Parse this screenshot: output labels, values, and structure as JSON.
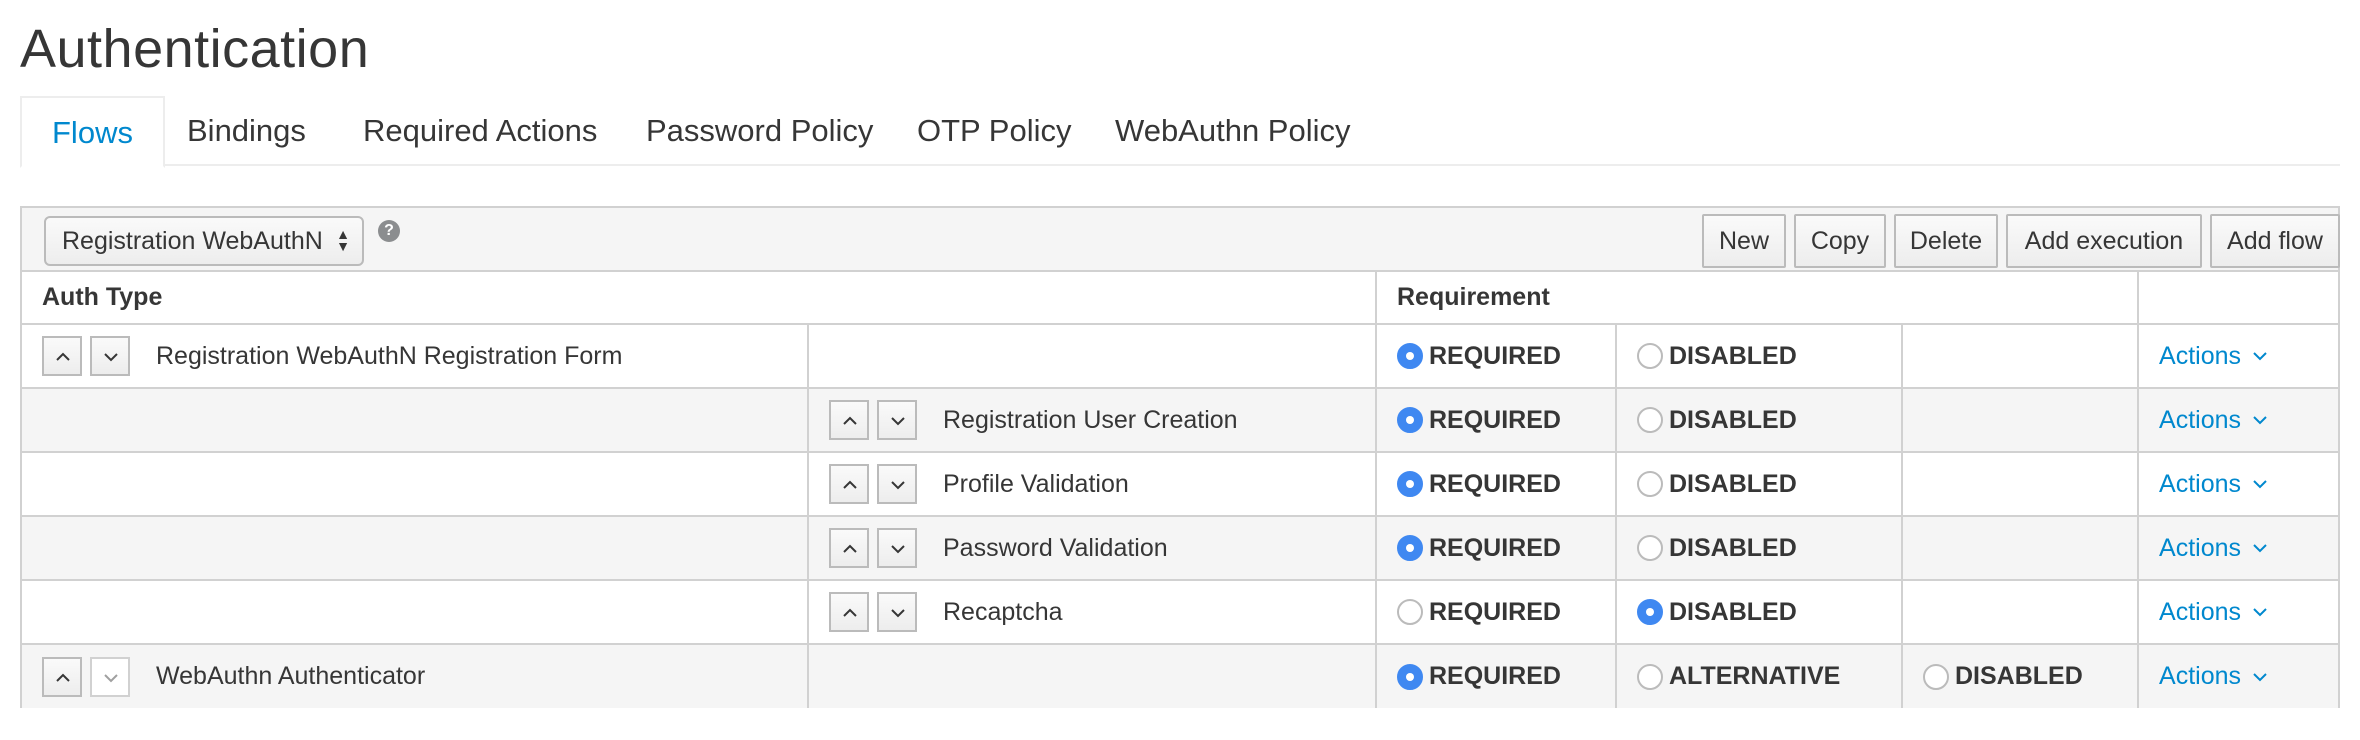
{
  "page": {
    "title": "Authentication"
  },
  "tabs": [
    {
      "label": "Flows",
      "active": true
    },
    {
      "label": "Bindings",
      "active": false
    },
    {
      "label": "Required Actions",
      "active": false
    },
    {
      "label": "Password Policy",
      "active": false
    },
    {
      "label": "OTP Policy",
      "active": false
    },
    {
      "label": "WebAuthn Policy",
      "active": false
    }
  ],
  "toolbar": {
    "flow_select_value": "Registration WebAuthN",
    "help_icon": "question-circle-icon",
    "buttons": {
      "new": "New",
      "copy": "Copy",
      "delete": "Delete",
      "add_execution": "Add execution",
      "add_flow": "Add flow"
    }
  },
  "table": {
    "headers": {
      "auth_type": "Auth Type",
      "requirement": "Requirement"
    },
    "rows": [
      {
        "name": "Registration WebAuthN Registration Form",
        "level": 0,
        "options": [
          "REQUIRED",
          "DISABLED"
        ],
        "selected": "REQUIRED",
        "actions": "Actions"
      },
      {
        "name": "Registration User Creation",
        "level": 1,
        "options": [
          "REQUIRED",
          "DISABLED"
        ],
        "selected": "REQUIRED",
        "actions": "Actions"
      },
      {
        "name": "Profile Validation",
        "level": 1,
        "options": [
          "REQUIRED",
          "DISABLED"
        ],
        "selected": "REQUIRED",
        "actions": "Actions"
      },
      {
        "name": "Password Validation",
        "level": 1,
        "options": [
          "REQUIRED",
          "DISABLED"
        ],
        "selected": "REQUIRED",
        "actions": "Actions"
      },
      {
        "name": "Recaptcha",
        "level": 1,
        "options": [
          "REQUIRED",
          "DISABLED"
        ],
        "selected": "DISABLED",
        "actions": "Actions"
      },
      {
        "name": "WebAuthn Authenticator",
        "level": 0,
        "options": [
          "REQUIRED",
          "ALTERNATIVE",
          "DISABLED"
        ],
        "selected": "REQUIRED",
        "actions": "Actions"
      }
    ]
  },
  "colors": {
    "accent": "#0088ce",
    "radio_on": "#3f88f1",
    "border": "#d1d1d1",
    "row_alt": "#f5f5f5"
  }
}
